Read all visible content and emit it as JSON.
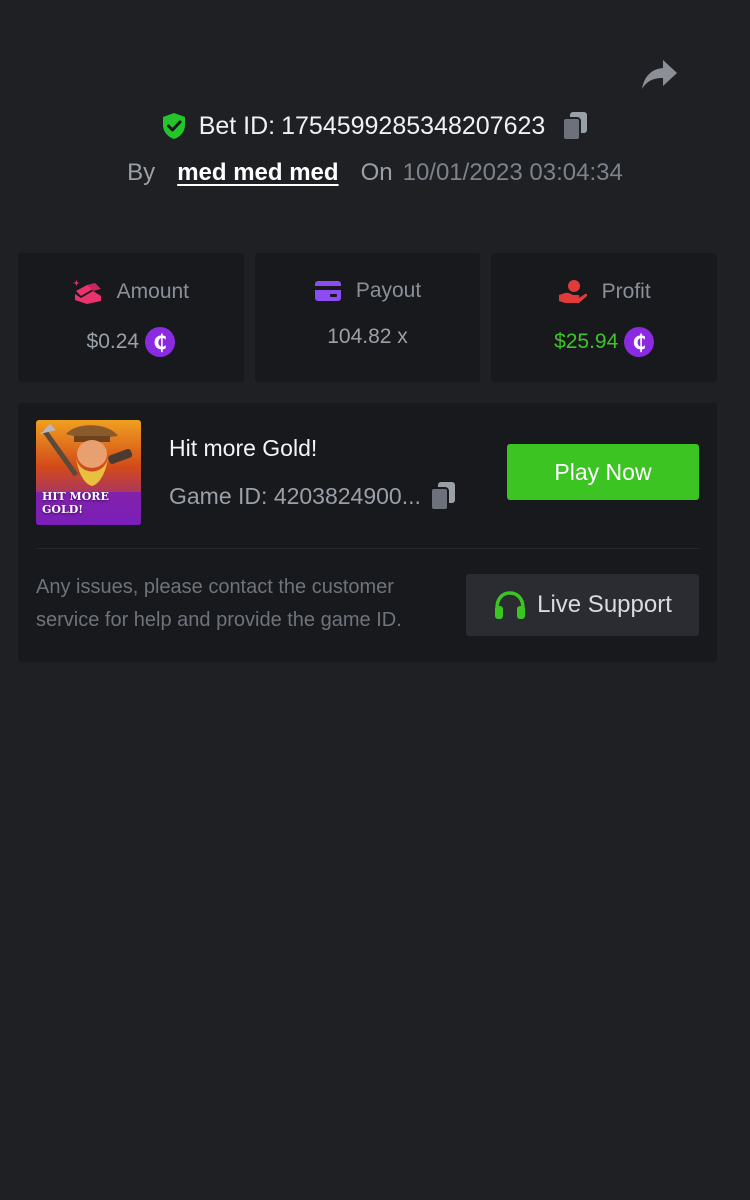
{
  "header": {
    "bet_label": "Bet ID:",
    "bet_id": "1754599285348207623",
    "by_label": "By",
    "username": "med med med",
    "on_label": "On",
    "timestamp": "10/01/2023 03:04:34"
  },
  "stats": {
    "amount": {
      "label": "Amount",
      "value": "$0.24"
    },
    "payout": {
      "label": "Payout",
      "value": "104.82 x"
    },
    "profit": {
      "label": "Profit",
      "value": "$25.94"
    }
  },
  "game": {
    "title": "Hit more Gold!",
    "id_label": "Game ID:",
    "id_value": "4203824900...",
    "thumb_text": "HIT MORE GOLD!",
    "play_label": "Play Now"
  },
  "support": {
    "help_text": "Any issues, please contact the customer service for help and provide the game ID.",
    "button_label": "Live Support"
  },
  "icons": {
    "share": "share-icon",
    "verified": "shield-check-icon",
    "copy": "copy-icon",
    "amount": "coins-icon",
    "payout": "card-icon",
    "profit": "hand-money-icon",
    "coin": "coin-icon",
    "support": "headset-icon"
  },
  "colors": {
    "background": "#1f2024",
    "card": "#18191d",
    "accent_green": "#3cc423",
    "profit_green": "#3ec42c",
    "coin_purple": "#8a2be2",
    "amount_pink": "#e8336e",
    "payout_purple": "#8b4df2",
    "profit_red": "#e03a3a"
  }
}
